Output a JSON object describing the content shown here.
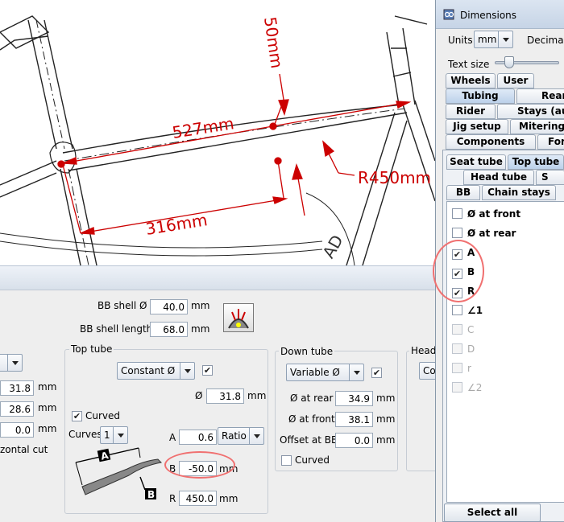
{
  "drawing": {
    "annotations": {
      "top_tube_length": "527mm",
      "bb_to_point_length": "316mm",
      "offset": "50mm",
      "radius": "R450mm"
    },
    "frame_label_partial": "AD"
  },
  "panel": {
    "bb_shell_diameter_label": "BB shell Ø",
    "bb_shell_diameter_value": "40.0",
    "bb_shell_length_label": "BB shell length",
    "bb_shell_length_value": "68.0",
    "unit": "mm",
    "left_column": {
      "values": [
        "31.8",
        "28.6",
        "0.0"
      ],
      "partial_label": "zontal cut"
    },
    "top_tube": {
      "title": "Top tube",
      "profile_select": "Constant Ø",
      "profile_checked": true,
      "diameter_label": "Ø",
      "diameter_value": "31.8",
      "curved_label": "Curved",
      "curved_checked": true,
      "curves_label": "Curves",
      "curves_value": "1",
      "a_label": "A",
      "a_value": "0.6",
      "a_mode": "Ratio",
      "b_label": "B",
      "b_value": "-50.0",
      "r_label": "R",
      "r_value": "450.0",
      "diagram_labels": [
        "A",
        "B"
      ]
    },
    "down_tube": {
      "title": "Down tube",
      "profile_select": "Variable Ø",
      "profile_checked": true,
      "at_rear_label": "Ø at rear",
      "at_rear_value": "34.9",
      "at_front_label": "Ø at front",
      "at_front_value": "38.1",
      "offset_label": "Offset at BB",
      "offset_value": "0.0",
      "curved_label": "Curved",
      "curved_checked": false
    },
    "head_tube": {
      "title": "Head",
      "select_partial": "Co"
    }
  },
  "dimensions_window": {
    "title": "Dimensions",
    "units_label": "Units",
    "units_value": "mm",
    "decimals_label": "Decimal",
    "text_size_label": "Text size",
    "text_size_fraction": 0.2,
    "tab_rows": [
      [
        "Wheels",
        "User"
      ],
      [
        "Tubing",
        "Rear"
      ],
      [
        "Rider",
        "Stays (aux"
      ],
      [
        "Jig setup",
        "Mitering"
      ],
      [
        "Components",
        "Fork"
      ]
    ],
    "selected_tab": "Tubing",
    "sub_tab_rows": [
      [
        "Seat tube",
        "Top tube"
      ],
      [
        "Head tube",
        "S"
      ],
      [
        "BB",
        "Chain stays"
      ]
    ],
    "selected_sub_tab": "Top tube",
    "items": [
      {
        "label": "Ø at front",
        "checked": false,
        "enabled": true
      },
      {
        "label": "Ø at rear",
        "checked": false,
        "enabled": true
      },
      {
        "label": "A",
        "checked": true,
        "enabled": true
      },
      {
        "label": "B",
        "checked": true,
        "enabled": true
      },
      {
        "label": "R",
        "checked": true,
        "enabled": true
      },
      {
        "label": "∠1",
        "checked": false,
        "enabled": true
      },
      {
        "label": "C",
        "checked": false,
        "enabled": false
      },
      {
        "label": "D",
        "checked": false,
        "enabled": false
      },
      {
        "label": "r",
        "checked": false,
        "enabled": false
      },
      {
        "label": "∠2",
        "checked": false,
        "enabled": false
      }
    ],
    "select_all_label": "Select all"
  },
  "colors": {
    "annotation_red": "#cc0000",
    "highlight_circle": "#f07070"
  }
}
